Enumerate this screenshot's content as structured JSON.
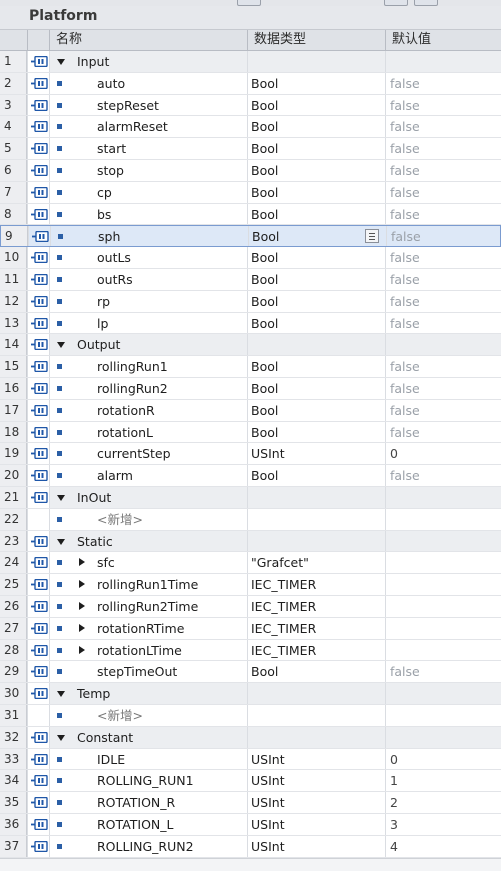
{
  "editor": {
    "title": "Platform",
    "columns": {
      "name": "名称",
      "data_type": "数据类型",
      "default_value": "默认值"
    }
  },
  "rows": [
    {
      "num": "1",
      "kind": "section",
      "name": "Input",
      "type": "",
      "def": ""
    },
    {
      "num": "2",
      "kind": "var",
      "name": "auto",
      "type": "Bool",
      "def": "false"
    },
    {
      "num": "3",
      "kind": "var",
      "name": "stepReset",
      "type": "Bool",
      "def": "false"
    },
    {
      "num": "4",
      "kind": "var",
      "name": "alarmReset",
      "type": "Bool",
      "def": "false"
    },
    {
      "num": "5",
      "kind": "var",
      "name": "start",
      "type": "Bool",
      "def": "false"
    },
    {
      "num": "6",
      "kind": "var",
      "name": "stop",
      "type": "Bool",
      "def": "false"
    },
    {
      "num": "7",
      "kind": "var",
      "name": "cp",
      "type": "Bool",
      "def": "false"
    },
    {
      "num": "8",
      "kind": "var",
      "name": "bs",
      "type": "Bool",
      "def": "false"
    },
    {
      "num": "9",
      "kind": "var",
      "name": "sph",
      "type": "Bool",
      "def": "false",
      "selected": true
    },
    {
      "num": "10",
      "kind": "var",
      "name": "outLs",
      "type": "Bool",
      "def": "false"
    },
    {
      "num": "11",
      "kind": "var",
      "name": "outRs",
      "type": "Bool",
      "def": "false"
    },
    {
      "num": "12",
      "kind": "var",
      "name": "rp",
      "type": "Bool",
      "def": "false"
    },
    {
      "num": "13",
      "kind": "var",
      "name": "lp",
      "type": "Bool",
      "def": "false"
    },
    {
      "num": "14",
      "kind": "section",
      "name": "Output",
      "type": "",
      "def": ""
    },
    {
      "num": "15",
      "kind": "var",
      "name": "rollingRun1",
      "type": "Bool",
      "def": "false"
    },
    {
      "num": "16",
      "kind": "var",
      "name": "rollingRun2",
      "type": "Bool",
      "def": "false"
    },
    {
      "num": "17",
      "kind": "var",
      "name": "rotationR",
      "type": "Bool",
      "def": "false"
    },
    {
      "num": "18",
      "kind": "var",
      "name": "rotationL",
      "type": "Bool",
      "def": "false"
    },
    {
      "num": "19",
      "kind": "var",
      "name": "currentStep",
      "type": "USInt",
      "def": "0"
    },
    {
      "num": "20",
      "kind": "var",
      "name": "alarm",
      "type": "Bool",
      "def": "false"
    },
    {
      "num": "21",
      "kind": "section",
      "name": "InOut",
      "type": "",
      "def": ""
    },
    {
      "num": "22",
      "kind": "add",
      "name": "<新增>",
      "type": "",
      "def": ""
    },
    {
      "num": "23",
      "kind": "section",
      "name": "Static",
      "type": "",
      "def": ""
    },
    {
      "num": "24",
      "kind": "struct",
      "name": "sfc",
      "type": "\"Grafcet\"",
      "def": ""
    },
    {
      "num": "25",
      "kind": "struct",
      "name": "rollingRun1Time",
      "type": "IEC_TIMER",
      "def": ""
    },
    {
      "num": "26",
      "kind": "struct",
      "name": "rollingRun2Time",
      "type": "IEC_TIMER",
      "def": ""
    },
    {
      "num": "27",
      "kind": "struct",
      "name": "rotationRTime",
      "type": "IEC_TIMER",
      "def": ""
    },
    {
      "num": "28",
      "kind": "struct",
      "name": "rotationLTime",
      "type": "IEC_TIMER",
      "def": ""
    },
    {
      "num": "29",
      "kind": "var",
      "name": "stepTimeOut",
      "type": "Bool",
      "def": "false"
    },
    {
      "num": "30",
      "kind": "section",
      "name": "Temp",
      "type": "",
      "def": ""
    },
    {
      "num": "31",
      "kind": "add",
      "name": "<新增>",
      "type": "",
      "def": ""
    },
    {
      "num": "32",
      "kind": "section",
      "name": "Constant",
      "type": "",
      "def": ""
    },
    {
      "num": "33",
      "kind": "var",
      "name": "IDLE",
      "type": "USInt",
      "def": "0"
    },
    {
      "num": "34",
      "kind": "var",
      "name": "ROLLING_RUN1",
      "type": "USInt",
      "def": "1"
    },
    {
      "num": "35",
      "kind": "var",
      "name": "ROTATION_R",
      "type": "USInt",
      "def": "2"
    },
    {
      "num": "36",
      "kind": "var",
      "name": "ROTATION_L",
      "type": "USInt",
      "def": "3"
    },
    {
      "num": "37",
      "kind": "var",
      "name": "ROLLING_RUN2",
      "type": "USInt",
      "def": "4"
    }
  ],
  "colors": {
    "selected_row": "#dde8f7",
    "section_row": "#eceef1",
    "accent": "#2b5fa6"
  },
  "icons": {
    "interface": "interface-icon",
    "member": "member-square-icon",
    "expand": "expand-triangle-icon",
    "collapse": "collapse-triangle-icon",
    "dropdown": "dropdown-list-icon"
  }
}
